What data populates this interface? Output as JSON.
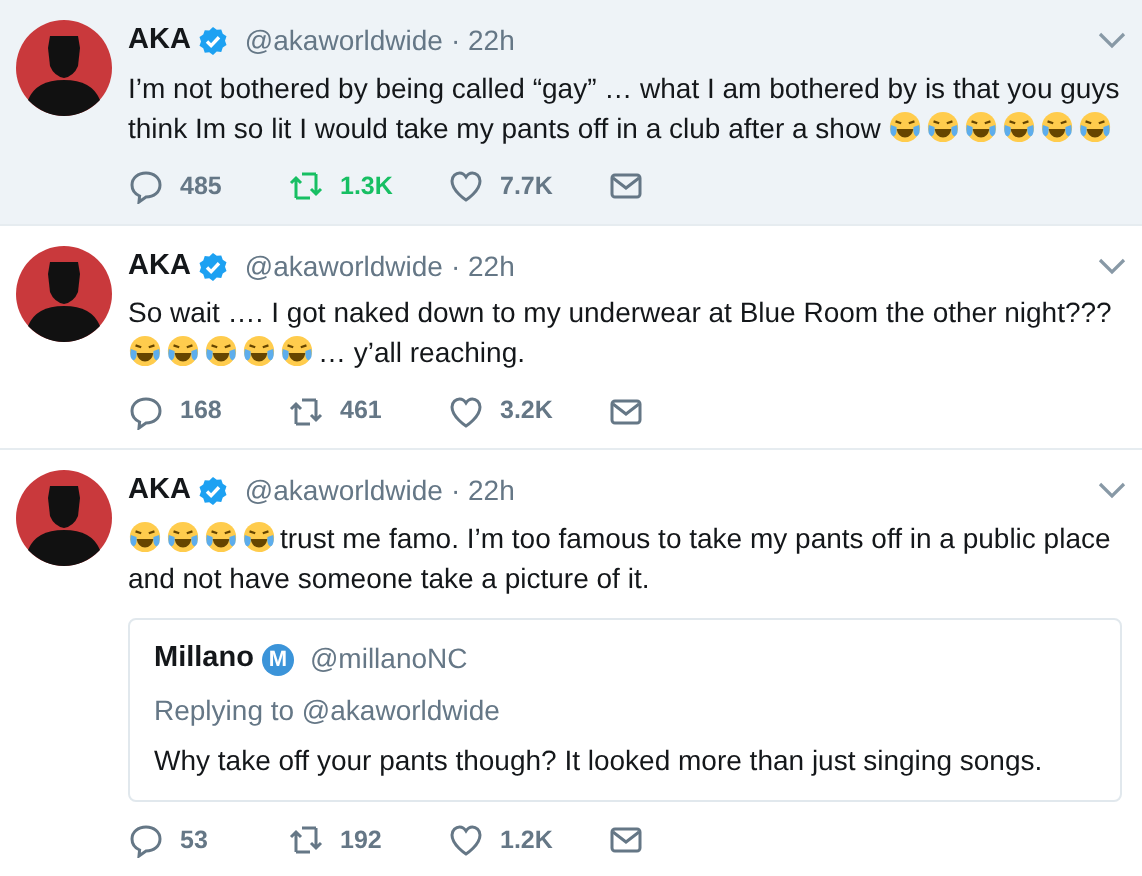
{
  "tweets": [
    {
      "name": "AKA",
      "verified": true,
      "handle": "@akaworldwide",
      "time": "· 22h",
      "highlighted": true,
      "content": [
        {
          "kind": "text",
          "text": "I’m not bothered by being called “gay” … what I am bothered by is that you guys"
        },
        {
          "kind": "break"
        },
        {
          "kind": "text",
          "text": "think Im so lit I would take my pants off in a club after a show"
        },
        {
          "kind": "emoji"
        },
        {
          "kind": "emoji"
        },
        {
          "kind": "emoji"
        },
        {
          "kind": "emoji"
        },
        {
          "kind": "emoji"
        },
        {
          "kind": "emoji"
        }
      ],
      "replies": "485",
      "retweets": "1.3K",
      "retweeted": true,
      "likes": "7.7K"
    },
    {
      "name": "AKA",
      "verified": true,
      "handle": "@akaworldwide",
      "time": "· 22h",
      "highlighted": false,
      "content": [
        {
          "kind": "text",
          "text": "So wait …. I got naked down to my underwear at Blue Room the other night???"
        },
        {
          "kind": "break"
        },
        {
          "kind": "emoji"
        },
        {
          "kind": "emoji"
        },
        {
          "kind": "emoji"
        },
        {
          "kind": "emoji"
        },
        {
          "kind": "emoji"
        },
        {
          "kind": "text",
          "text": "… y’all reaching."
        }
      ],
      "replies": "168",
      "retweets": "461",
      "retweeted": false,
      "likes": "3.2K"
    },
    {
      "name": "AKA",
      "verified": true,
      "handle": "@akaworldwide",
      "time": "· 22h",
      "highlighted": false,
      "content": [
        {
          "kind": "emoji"
        },
        {
          "kind": "emoji"
        },
        {
          "kind": "emoji"
        },
        {
          "kind": "emoji"
        },
        {
          "kind": "text",
          "text": "trust me famo. I’m too famous to take my pants off in a public place"
        },
        {
          "kind": "break"
        },
        {
          "kind": "text",
          "text": "and not have someone take a picture of it."
        }
      ],
      "quote": {
        "name": "Millano",
        "badge": "M",
        "handle": "@millanoNC",
        "replying_to": "Replying to @akaworldwide",
        "text": "Why take off your pants though? It looked more than just singing songs."
      },
      "replies": "53",
      "retweets": "192",
      "retweeted": false,
      "likes": "1.2K"
    }
  ]
}
